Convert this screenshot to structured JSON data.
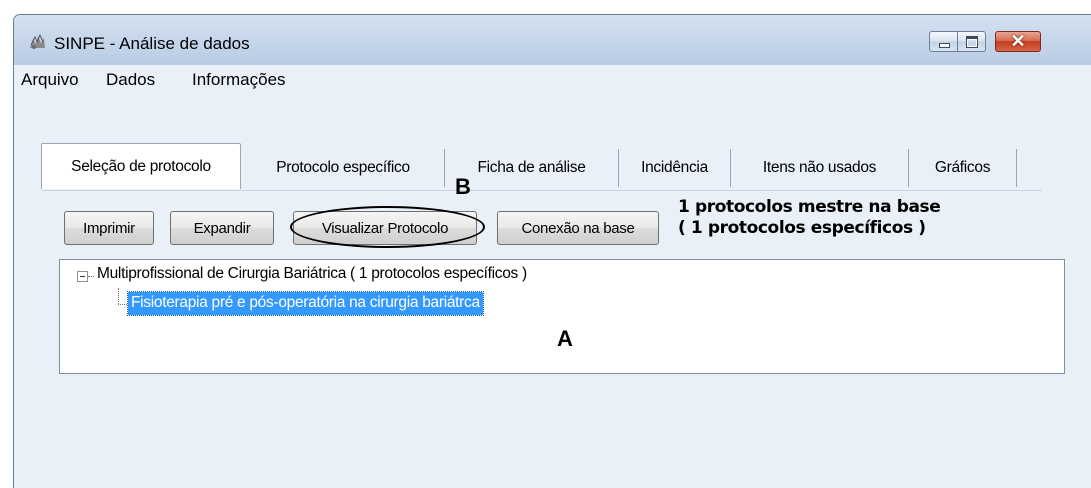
{
  "window": {
    "title": "SINPE - Análise de dados",
    "icon": "app-icon",
    "controls": {
      "minimize": "minimize-icon",
      "maximize": "maximize-icon",
      "close": "close-icon",
      "close_glyph": "✕"
    }
  },
  "menu": {
    "items": [
      "Arquivo",
      "Dados",
      "Informações"
    ]
  },
  "tabs": [
    {
      "label": "Seleção de protocolo",
      "selected": true
    },
    {
      "label": "Protocolo específico",
      "selected": false
    },
    {
      "label": "Ficha de análise",
      "selected": false
    },
    {
      "label": "Incidência",
      "selected": false
    },
    {
      "label": "Itens não usados",
      "selected": false
    },
    {
      "label": "Gráficos",
      "selected": false
    }
  ],
  "toolbar": {
    "print_label": "Imprimir",
    "expand_label": "Expandir",
    "view_protocol_label": "Visualizar Protocolo",
    "connection_label": "Conexão na base"
  },
  "status": {
    "line1": "1 protocolos mestre na base",
    "line2": "( 1 protocolos específicos )"
  },
  "annotations": {
    "b": "B",
    "a": "A"
  },
  "tree": {
    "root": {
      "label": "Multiprofissional de Cirurgia Bariátrica ( 1 protocolos específicos )",
      "expanded": true,
      "children": [
        {
          "label": "Fisioterapia pré e pós-operatória na cirurgia bariátrca",
          "selected": true
        }
      ]
    }
  },
  "colors": {
    "selection": "#3399ff",
    "window_bg": "#eaf0f7",
    "close_button": "#c43c1d"
  }
}
